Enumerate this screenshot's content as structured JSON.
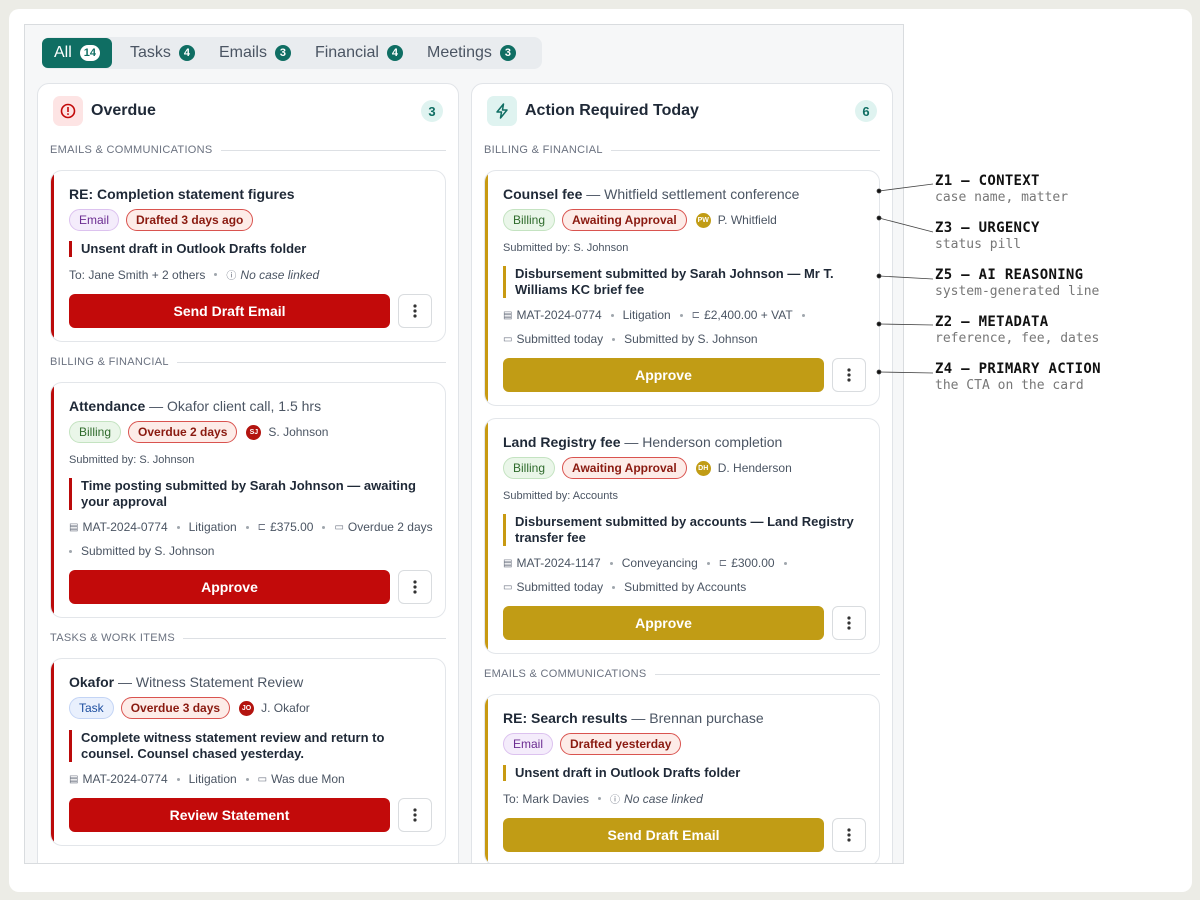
{
  "tabs": [
    {
      "label": "All",
      "count": "14"
    },
    {
      "label": "Tasks",
      "count": "4"
    },
    {
      "label": "Emails",
      "count": "3"
    },
    {
      "label": "Financial",
      "count": "4"
    },
    {
      "label": "Meetings",
      "count": "3"
    }
  ],
  "overdue": {
    "title": "Overdue",
    "count": "3",
    "sections": {
      "emails": "EMAILS & COMMUNICATIONS",
      "billing": "BILLING & FINANCIAL",
      "tasks": "TASKS & WORK ITEMS"
    },
    "cards": [
      {
        "title": "RE: Completion statement figures",
        "type": "Email",
        "status": "Drafted 3 days ago",
        "reason": "Unsent draft in Outlook Drafts folder",
        "to": "To: Jane Smith + 2 others",
        "case": "No case linked",
        "action": "Send Draft Email"
      },
      {
        "title": "Attendance",
        "subtitle": "— Okafor client call, 1.5 hrs",
        "type": "Billing",
        "status": "Overdue 2 days",
        "initials": "SJ",
        "person": "S. Johnson",
        "submitted_by": "Submitted by: S. Johnson",
        "reason": "Time posting submitted by Sarah Johnson — awaiting your approval",
        "matter": "MAT-2024-0774",
        "area": "Litigation",
        "fee": "£375.00",
        "due": "Overdue 2 days",
        "submitter": "Submitted by S. Johnson",
        "action": "Approve"
      },
      {
        "title": "Okafor",
        "subtitle": "— Witness Statement Review",
        "type": "Task",
        "status": "Overdue 3 days",
        "initials": "JO",
        "person": "J. Okafor",
        "reason": "Complete witness statement review and return to counsel. Counsel chased yesterday.",
        "matter": "MAT-2024-0774",
        "area": "Litigation",
        "due": "Was due Mon",
        "action": "Review Statement"
      }
    ]
  },
  "today": {
    "title": "Action Required Today",
    "count": "6",
    "sections": {
      "billing": "BILLING & FINANCIAL",
      "emails": "EMAILS & COMMUNICATIONS"
    },
    "cards": [
      {
        "title": "Counsel fee",
        "subtitle": "— Whitfield settlement conference",
        "type": "Billing",
        "status": "Awaiting Approval",
        "initials": "PW",
        "person": "P. Whitfield",
        "submitted_by": "Submitted by: S. Johnson",
        "reason": "Disbursement submitted by Sarah Johnson — Mr T. Williams KC brief fee",
        "matter": "MAT-2024-0774",
        "area": "Litigation",
        "fee": "£2,400.00 + VAT",
        "date": "Submitted today",
        "submitter": "Submitted by S. Johnson",
        "action": "Approve"
      },
      {
        "title": "Land Registry fee",
        "subtitle": "— Henderson completion",
        "type": "Billing",
        "status": "Awaiting Approval",
        "initials": "DH",
        "person": "D. Henderson",
        "submitted_by": "Submitted by: Accounts",
        "reason": "Disbursement submitted by accounts — Land Registry transfer fee",
        "matter": "MAT-2024-1147",
        "area": "Conveyancing",
        "fee": "£300.00",
        "date": "Submitted today",
        "submitter": "Submitted by Accounts",
        "action": "Approve"
      },
      {
        "title": "RE: Search results",
        "subtitle": "— Brennan purchase",
        "type": "Email",
        "status": "Drafted yesterday",
        "reason": "Unsent draft in Outlook Drafts folder",
        "to": "To: Mark Davies",
        "case": "No case linked",
        "action": "Send Draft Email"
      }
    ]
  },
  "annotations": [
    {
      "head": "Z1 — CONTEXT",
      "desc": "case name, matter"
    },
    {
      "head": "Z3 — URGENCY",
      "desc": "status pill"
    },
    {
      "head": "Z5 — AI REASONING",
      "desc": "system-generated line"
    },
    {
      "head": "Z2 — METADATA",
      "desc": "reference, fee, dates"
    },
    {
      "head": "Z4 — PRIMARY ACTION",
      "desc": "the CTA on the card"
    }
  ],
  "colors": {
    "teal": "#0f6e63",
    "overdue_red": "#c20a0a",
    "today_gold": "#c19c15"
  }
}
